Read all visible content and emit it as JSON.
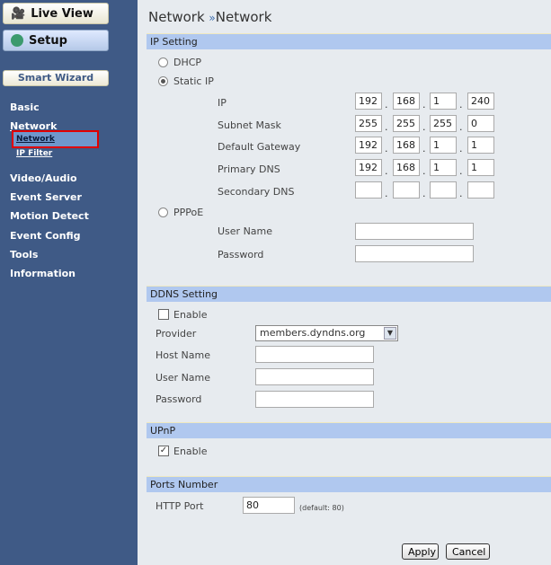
{
  "sidebar": {
    "live_view": "Live View",
    "setup": "Setup",
    "smart_wizard": "Smart Wizard",
    "items": [
      "Basic",
      "Network",
      "Video/Audio",
      "Event Server",
      "Motion Detect",
      "Event Config",
      "Tools",
      "Information"
    ],
    "network_sub": [
      "Network",
      "IP Filter"
    ]
  },
  "page": {
    "title": "Network",
    "separator": "»",
    "subtitle": "Network"
  },
  "ip": {
    "header": "IP Setting",
    "dhcp": "DHCP",
    "static": "Static IP",
    "pppoe": "PPPoE",
    "labels": [
      "IP",
      "Subnet Mask",
      "Default Gateway",
      "Primary DNS",
      "Secondary DNS"
    ],
    "values": [
      [
        "192",
        "168",
        "1",
        "240"
      ],
      [
        "255",
        "255",
        "255",
        "0"
      ],
      [
        "192",
        "168",
        "1",
        "1"
      ],
      [
        "192",
        "168",
        "1",
        "1"
      ],
      [
        "",
        "",
        "",
        ""
      ]
    ],
    "user_name": "User Name",
    "password": "Password",
    "user_value": "",
    "password_value": ""
  },
  "ddns": {
    "header": "DDNS Setting",
    "enable": "Enable",
    "provider_label": "Provider",
    "provider": "members.dyndns.org",
    "host": "Host Name",
    "user": "User Name",
    "password": "Password"
  },
  "upnp": {
    "header": "UPnP",
    "enable": "Enable"
  },
  "ports": {
    "header": "Ports Number",
    "http_label": "HTTP Port",
    "http_value": "80",
    "default_note": "(default: 80)"
  },
  "buttons": {
    "apply": "Apply",
    "cancel": "Cancel"
  }
}
